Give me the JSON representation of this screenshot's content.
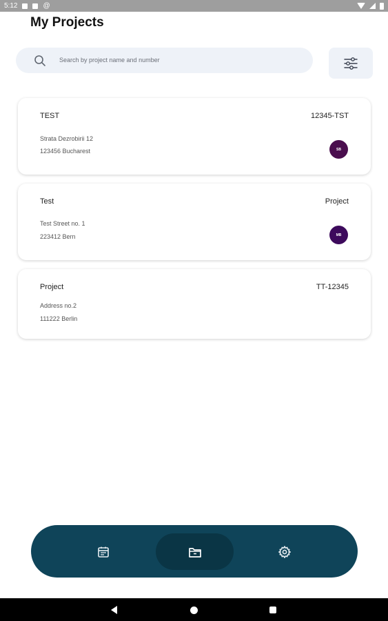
{
  "status_bar": {
    "time": "5:12",
    "notification_icons": [
      "square-icon",
      "square-icon",
      "at-icon"
    ],
    "system_icons": [
      "wifi-icon",
      "signal-icon",
      "battery-icon"
    ]
  },
  "header": {
    "title": "My Projects"
  },
  "search": {
    "placeholder": "Search by project name and number",
    "icon": "search-icon",
    "filter_icon": "sliders-icon"
  },
  "projects": [
    {
      "name": "TEST",
      "code": "12345-TST",
      "address_line1": "Strata Dezrobirii 12",
      "address_line2": "123456 Bucharest",
      "avatar_initials": "SB",
      "avatar_color": "#4a0e4e"
    },
    {
      "name": "Test",
      "code": "Project",
      "address_line1": "Test Street no. 1",
      "address_line2": "223412 Bern",
      "avatar_initials": "MB",
      "avatar_color": "#3d0a5c"
    },
    {
      "name": "Project",
      "code": "TT-12345",
      "address_line1": "Address no.2",
      "address_line2": "111222 Berlin"
    }
  ],
  "bottom_nav": {
    "background": "#0f4459",
    "active_background": "#0a3545",
    "items": [
      {
        "icon": "calendar-icon",
        "active": false
      },
      {
        "icon": "folder-icon",
        "active": true
      },
      {
        "icon": "gear-icon",
        "active": false
      }
    ]
  },
  "system_nav": {
    "icons": [
      "back-icon",
      "home-icon",
      "recents-icon"
    ]
  }
}
